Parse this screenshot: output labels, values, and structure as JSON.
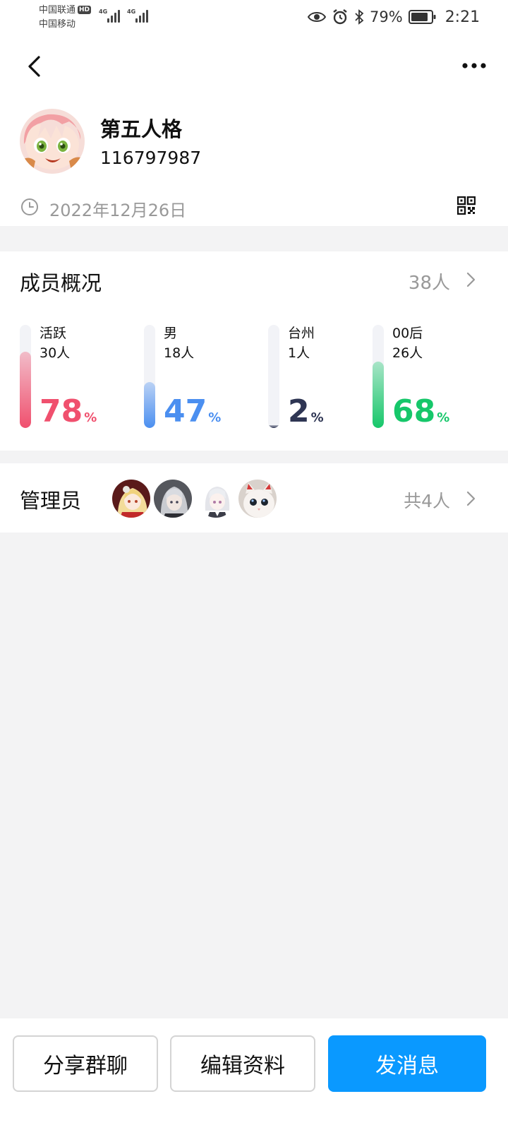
{
  "status_bar": {
    "carrier1": "中国联通",
    "carrier1_badge": "HD",
    "carrier2": "中国移动",
    "network1": "4G",
    "network2": "4G",
    "battery": "79%",
    "time": "2:21"
  },
  "header": {
    "group_name": "第五人格",
    "group_id": "116797987",
    "created_date": "2022年12月26日"
  },
  "members": {
    "title": "成员概况",
    "count": "38人",
    "stats": [
      {
        "label": "活跃",
        "count": "30人",
        "percent": "78",
        "unit": "%",
        "level": 0.78,
        "color": "#f0506e"
      },
      {
        "label": "男",
        "count": "18人",
        "percent": "47",
        "unit": "%",
        "level": 0.47,
        "color": "#4b8ff0"
      },
      {
        "label": "台州",
        "count": "1人",
        "percent": "2",
        "unit": "%",
        "level": 0.02,
        "color": "#2e3553"
      },
      {
        "label": "00后",
        "count": "26人",
        "percent": "68",
        "unit": "%",
        "level": 0.68,
        "color": "#16c76a"
      }
    ]
  },
  "admins": {
    "title": "管理员",
    "total": "共4人"
  },
  "actions": {
    "share": "分享群聊",
    "edit": "编辑资料",
    "message": "发消息"
  },
  "colors": {
    "primary": "#0a99ff",
    "muted_text": "#999999",
    "background": "#f3f3f4"
  }
}
